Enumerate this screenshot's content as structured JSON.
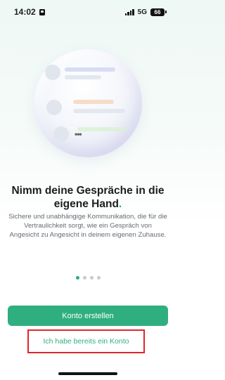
{
  "status_bar": {
    "time": "14:02",
    "network": "5G",
    "battery": "66"
  },
  "onboarding": {
    "headline_main": "Nimm deine Gespräche in die eigene Hand",
    "headline_end": ".",
    "body": "Sichere und unabhängige Kommunikation, die für die Vertraulichkeit sorgt, wie ein Gespräch von Angesicht zu Angesicht in deinem eigenen Zuhause.",
    "pager": {
      "total": 4,
      "active_index": 0
    }
  },
  "actions": {
    "create_account_label": "Konto erstellen",
    "have_account_label": "Ich habe bereits ein Konto"
  },
  "colors": {
    "accent": "#2faf7f",
    "highlight_border": "#e0252b"
  }
}
